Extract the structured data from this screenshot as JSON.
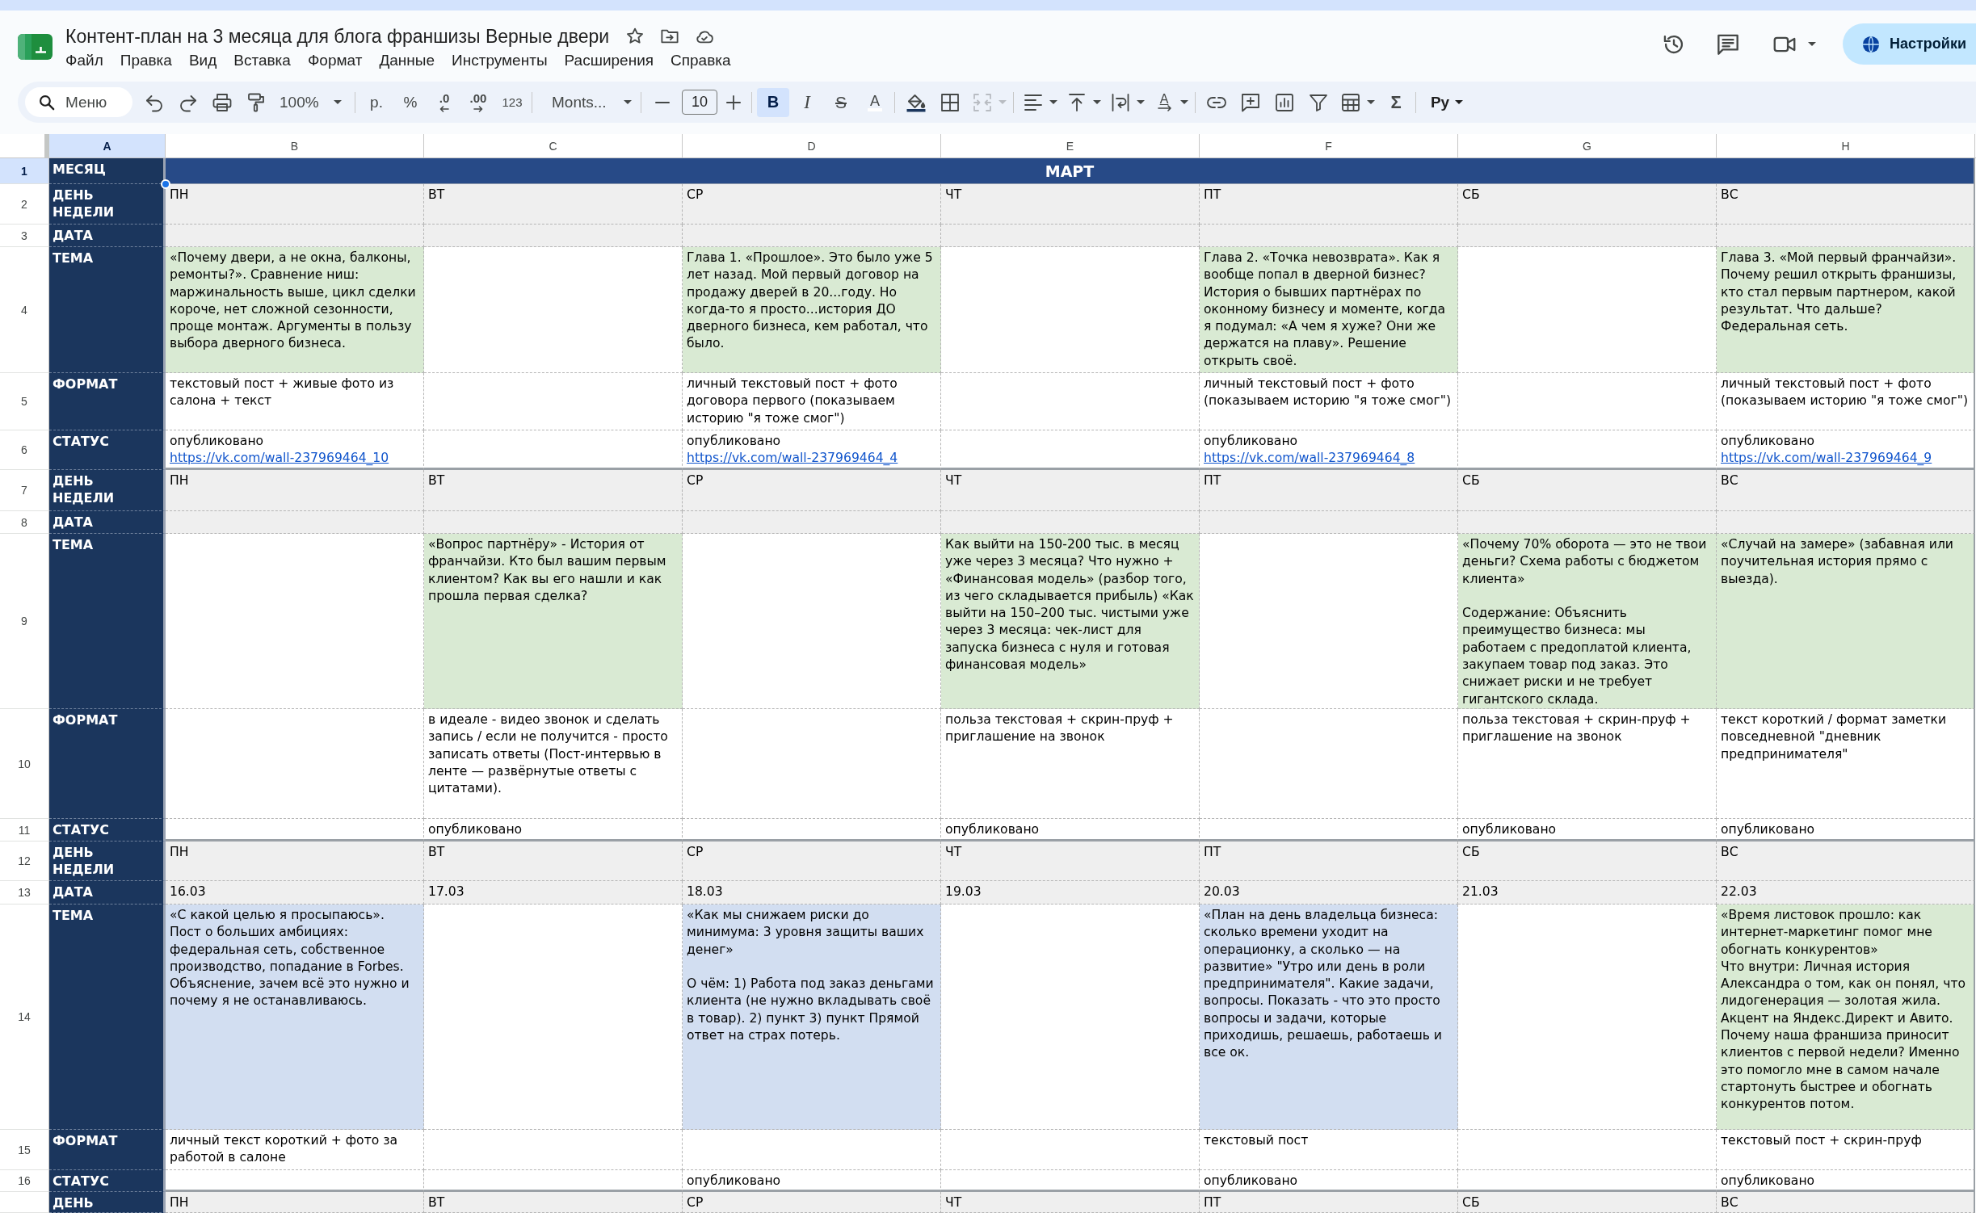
{
  "app": {
    "title": "Контент-план на 3 месяца для блога франшизы Верные двери",
    "menu": [
      "Файл",
      "Правка",
      "Вид",
      "Вставка",
      "Формат",
      "Данные",
      "Инструменты",
      "Расширения",
      "Справка"
    ],
    "share_button": "Настройки"
  },
  "toolbar": {
    "search": {
      "placeholder": "Меню"
    },
    "zoom": "100%",
    "currency": "р.",
    "percent": "%",
    "decimal_decrease": ".0",
    "decimal_increase": ".00",
    "number_format": "123",
    "font": "Monts...",
    "font_size": "10",
    "bold": {
      "label": "B",
      "selected": true
    },
    "italic": {
      "label": "I",
      "selected": false
    },
    "strikethrough": {
      "label": "S",
      "selected": false
    },
    "text_color": "A",
    "merge": {
      "disabled": true
    },
    "text_rotation": "A",
    "functions": "Σ",
    "input_tools": "Ру"
  },
  "sheet": {
    "columns": [
      {
        "label": "A",
        "selected": true
      },
      {
        "label": "B",
        "selected": false
      },
      {
        "label": "C",
        "selected": false
      },
      {
        "label": "D",
        "selected": false
      },
      {
        "label": "E",
        "selected": false
      },
      {
        "label": "F",
        "selected": false
      },
      {
        "label": "G",
        "selected": false
      },
      {
        "label": "H",
        "selected": false
      }
    ],
    "rows": [
      {
        "number": "1",
        "selected": true,
        "kind": "month",
        "label": "МЕСЯЦ",
        "month": "МАРТ"
      },
      {
        "number": "2",
        "selected": false,
        "kind": "day",
        "label": "ДЕНЬ\nНЕДЕЛИ",
        "cells": [
          {
            "text": "ПН"
          },
          {
            "text": "ВТ"
          },
          {
            "text": "СР"
          },
          {
            "text": "ЧТ"
          },
          {
            "text": "ПТ"
          },
          {
            "text": "СБ"
          },
          {
            "text": "ВС"
          }
        ]
      },
      {
        "number": "3",
        "selected": false,
        "kind": "date",
        "label": "ДАТА"
      },
      {
        "number": "4",
        "selected": false,
        "kind": "topic",
        "label": "ТЕМА",
        "cells": [
          {
            "text": "«Почему двери, а не окна, балконы, ремонты?». Сравнение ниш: маржинальность выше, цикл сделки короче, нет сложной сезонности, проще монтаж. Аргументы в пользу выбора дверного бизнеса.",
            "color": "#d9ead3"
          },
          null,
          {
            "text": "Глава 1. «Прошлое». Это было уже 5 лет назад. Мой первый договор на продажу дверей в 20...году. Но когда-то я просто...история ДО дверного бизнеса, кем работал, что было.",
            "color": "#d9ead3"
          },
          null,
          {
            "text": "Глава 2. «Точка невозврата». Как я вообще попал в дверной бизнес? История о бывших партнёрах по оконному бизнесу и моменте, когда я подумал: «А чем я хуже? Они же держатся на плаву». Решение открыть своё.",
            "color": "#d9ead3"
          },
          null,
          {
            "text": "Глава 3. «Мой первый франчайзи». Почему решил открыть франшизы, кто стал первым партнером, какой результат. Что дальше? Федеральная сеть.",
            "color": "#d9ead3"
          }
        ]
      },
      {
        "number": "5",
        "selected": false,
        "kind": "format",
        "label": "ФОРМАТ",
        "cells": [
          {
            "text": "текстовый пост + живые фото из салона + текст"
          },
          null,
          {
            "text": "личный текстовый пост + фото договора первого (показываем историю \"я тоже смог\")"
          },
          null,
          {
            "text": "личный текстовый пост + фото (показываем историю \"я тоже смог\")"
          },
          null,
          {
            "text": "личный текстовый пост + фото (показываем историю \"я тоже смог\")"
          }
        ]
      },
      {
        "number": "6",
        "selected": false,
        "kind": "status",
        "label": "СТАТУС",
        "cells": [
          {
            "text": "опубликовано",
            "link": "https://vk.com/wall-237969464_10"
          },
          null,
          {
            "text": "опубликовано",
            "link": "https://vk.com/wall-237969464_4"
          },
          null,
          {
            "text": "опубликовано",
            "link": "https://vk.com/wall-237969464_8"
          },
          null,
          {
            "text": "опубликовано",
            "link": "https://vk.com/wall-237969464_9"
          }
        ]
      },
      {
        "number": "7",
        "selected": false,
        "kind": "day",
        "label": "ДЕНЬ\nНЕДЕЛИ",
        "cells": [
          {
            "text": "ПН"
          },
          {
            "text": "ВТ"
          },
          {
            "text": "СР"
          },
          {
            "text": "ЧТ"
          },
          {
            "text": "ПТ"
          },
          {
            "text": "СБ"
          },
          {
            "text": "ВС"
          }
        ]
      },
      {
        "number": "8",
        "selected": false,
        "kind": "date",
        "label": "ДАТА"
      },
      {
        "number": "9",
        "selected": false,
        "kind": "topic",
        "label": "ТЕМА",
        "cells": [
          null,
          {
            "text": "«Вопрос партнёру» - История от франчайзи. Кто был вашим первым клиентом? Как вы его нашли и как прошла первая сделка?",
            "color": "#d9ead3"
          },
          null,
          {
            "text": "Как выйти на 150-200 тыс. в месяц уже через 3 месяца? Что нужно + «Финансовая модель» (разбор того, из чего складывается прибыль) «Как выйти на 150–200 тыс. чистыми уже через 3 месяца: чек-лист для запуска бизнеса с нуля и готовая финансовая модель»",
            "color": "#d9ead3"
          },
          null,
          {
            "text": "«Почему 70% оборота — это не твои деньги? Схема работы с бюджетом клиента»\n\nСодержание: Объяснить преимущество бизнеса: мы работаем с предоплатой клиента, закупаем товар под заказ. Это снижает риски и не требует гигантского склада.",
            "color": "#d9ead3"
          },
          {
            "text": "«Случай на замере» (забавная или поучительная история прямо с выезда).",
            "color": "#d9ead3"
          }
        ]
      },
      {
        "number": "10",
        "selected": false,
        "kind": "format",
        "label": "ФОРМАТ",
        "cells": [
          null,
          {
            "text": "в идеале - видео звонок и сделать запись / если не получится - просто записать ответы (Пост-интервью в ленте — развёрнутые ответы с цитатами)."
          },
          null,
          {
            "text": "польза текстовая + скрин-пруф + приглашение на звонок"
          },
          null,
          {
            "text": "польза текстовая + скрин-пруф + приглашение на звонок"
          },
          {
            "text": "текст короткий / формат заметки повседневной \"дневник предпринимателя\""
          }
        ]
      },
      {
        "number": "11",
        "selected": false,
        "kind": "status",
        "label": "СТАТУС",
        "cells": [
          null,
          {
            "text": "опубликовано"
          },
          null,
          {
            "text": "опубликовано"
          },
          null,
          {
            "text": "опубликовано"
          },
          {
            "text": "опубликовано"
          }
        ]
      },
      {
        "number": "12",
        "selected": false,
        "kind": "day",
        "label": "ДЕНЬ\nНЕДЕЛИ",
        "cells": [
          {
            "text": "ПН"
          },
          {
            "text": "ВТ"
          },
          {
            "text": "СР"
          },
          {
            "text": "ЧТ"
          },
          {
            "text": "ПТ"
          },
          {
            "text": "СБ"
          },
          {
            "text": "ВС"
          }
        ]
      },
      {
        "number": "13",
        "selected": false,
        "kind": "date",
        "label": "ДАТА",
        "cells": [
          {
            "text": "16.03"
          },
          {
            "text": "17.03"
          },
          {
            "text": "18.03"
          },
          {
            "text": "19.03"
          },
          {
            "text": "20.03"
          },
          {
            "text": "21.03"
          },
          {
            "text": "22.03"
          }
        ]
      },
      {
        "number": "14",
        "selected": false,
        "kind": "topic",
        "label": "ТЕМА",
        "cells": [
          {
            "text": "«С какой целью я просыпаюсь». Пост о больших амбициях: федеральная сеть, собственное производство, попадание в Forbes. Объяснение, зачем всё это нужно и почему я не останавливаюсь.",
            "color": "#d2def1"
          },
          null,
          {
            "text": "«Как мы снижаем риски до минимума: 3 уровня защиты ваших денег»\n\nО чём: 1) Работа под заказ деньгами клиента (не нужно вкладывать своё в товар). 2) пункт 3) пункт Прямой ответ на страх потерь.",
            "color": "#d2def1"
          },
          null,
          {
            "text": "«План на день владельца бизнеса: сколько времени уходит на операционку, а сколько — на развитие» \"Утро или день в роли предпринимателя\". Какие задачи, вопросы. Показать - что это просто вопросы и задачи, которые приходишь, решаешь, работаешь и все ок.",
            "color": "#d2def1"
          },
          null,
          {
            "text": "«Время листовок прошло: как интернет-маркетинг помог мне обогнать конкурентов»\nЧто внутри: Личная история Александра о том, как он понял, что лидогенерация — золотая жила. Акцент на Яндекс.Директ и Авито. Почему наша франшиза приносит клиентов с первой недели? Именно это помогло мне в самом начале стартонуть быстрее и обогнать конкурентов потом.",
            "color": "#d9ead3"
          }
        ]
      },
      {
        "number": "15",
        "selected": false,
        "kind": "format",
        "label": "ФОРМАТ",
        "cells": [
          {
            "text": "личный текст короткий + фото за работой в салоне"
          },
          null,
          null,
          null,
          {
            "text": "текстовый пост"
          },
          null,
          {
            "text": "текстовый пост + скрин-пруф"
          }
        ]
      },
      {
        "number": "16",
        "selected": false,
        "kind": "status",
        "label": "СТАТУС",
        "cells": [
          null,
          null,
          {
            "text": "опубликовано"
          },
          null,
          {
            "text": "опубликовано"
          },
          null,
          {
            "text": "опубликовано"
          }
        ]
      },
      {
        "selected": false,
        "kind": "day",
        "label": "ДЕНЬ",
        "cells": [
          {
            "text": "ПН"
          },
          {
            "text": "ВТ"
          },
          {
            "text": "СР"
          },
          {
            "text": "ЧТ"
          },
          {
            "text": "ПТ"
          },
          {
            "text": "СБ"
          },
          {
            "text": "ВС"
          }
        ]
      }
    ]
  }
}
